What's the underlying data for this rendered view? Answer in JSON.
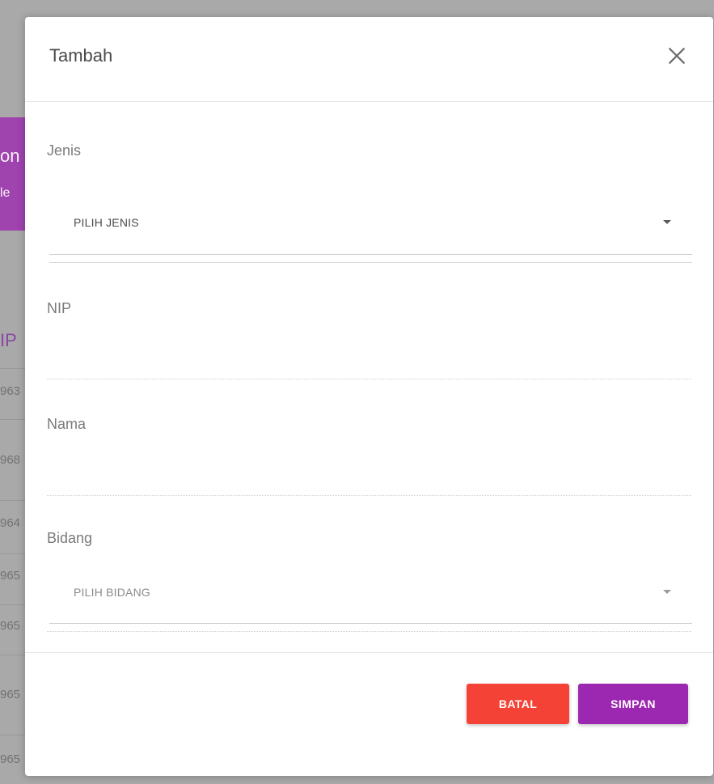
{
  "background": {
    "banner_text_1": "on",
    "banner_text_2": "le",
    "table_header": "IP",
    "rows": [
      "963",
      "968",
      "964",
      "965",
      "965",
      "965",
      "965"
    ]
  },
  "modal": {
    "title": "Tambah",
    "fields": {
      "jenis": {
        "label": "Jenis",
        "selected": "PILIH JENIS"
      },
      "nip": {
        "label": "NIP",
        "value": ""
      },
      "nama": {
        "label": "Nama",
        "value": ""
      },
      "bidang": {
        "label": "Bidang",
        "selected": "PILIH BIDANG"
      }
    },
    "buttons": {
      "cancel": "BATAL",
      "save": "SIMPAN"
    }
  },
  "colors": {
    "purple": "#9c27b0",
    "red": "#f44336",
    "overlay": "#a9a9a9"
  }
}
